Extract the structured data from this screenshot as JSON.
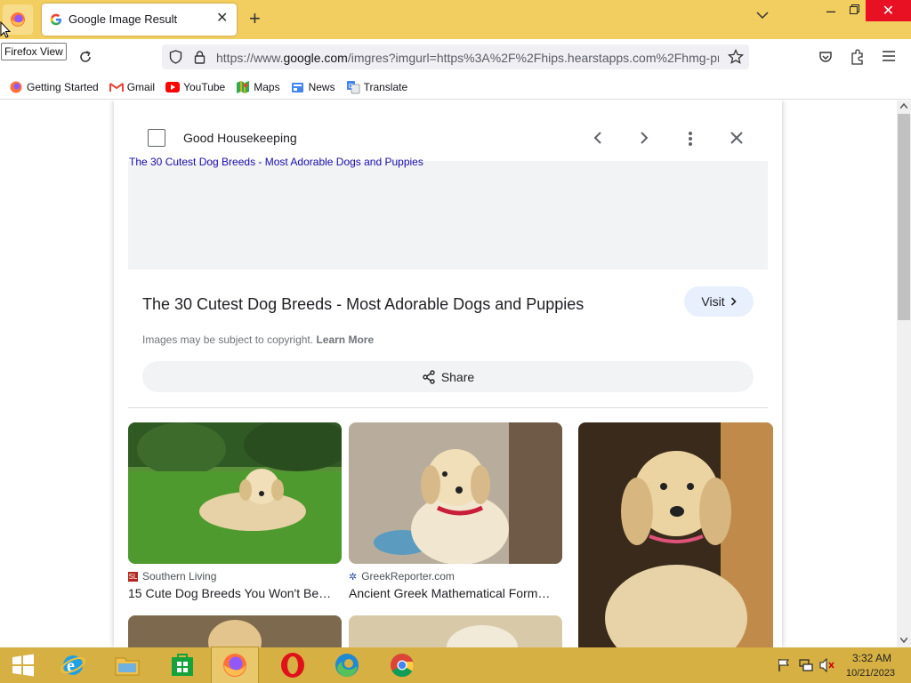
{
  "browser": {
    "tooltip": "Firefox View",
    "tab": {
      "title": "Google Image Result"
    },
    "url": {
      "prefix": "https://www.",
      "host": "google.com",
      "rest": "/imgres?imgurl=https%3A%2F%2Fhips.hearstapps.com%2Fhmg-pro"
    },
    "bookmarks": [
      {
        "label": "Getting Started",
        "icon": "firefox-icon"
      },
      {
        "label": "Gmail",
        "icon": "gmail-icon"
      },
      {
        "label": "YouTube",
        "icon": "youtube-icon"
      },
      {
        "label": "Maps",
        "icon": "maps-icon"
      },
      {
        "label": "News",
        "icon": "news-icon"
      },
      {
        "label": "Translate",
        "icon": "translate-icon"
      }
    ]
  },
  "panel": {
    "source_name": "Good Housekeeping",
    "preview_caption": "The 30 Cutest Dog Breeds - Most Adorable Dogs and Puppies",
    "title": "The 30 Cutest Dog Breeds - Most Adorable Dogs and Puppies",
    "visit_label": "Visit",
    "copyright_text": "Images may be subject to copyright.",
    "learn_more": "Learn More",
    "share_label": "Share"
  },
  "related": [
    {
      "source": "Southern Living",
      "title": "15 Cute Dog Breeds You Won't Be…"
    },
    {
      "source": "GreekReporter.com",
      "title": "Ancient Greek Mathematical Form…"
    }
  ],
  "taskbar": {
    "time": "3:32 AM",
    "date": "10/21/2023"
  },
  "colors": {
    "titlebar": "#f2cd5f",
    "taskbar": "#d6b043",
    "link": "#1a0dab",
    "visit_bg": "#e8f0fe"
  }
}
